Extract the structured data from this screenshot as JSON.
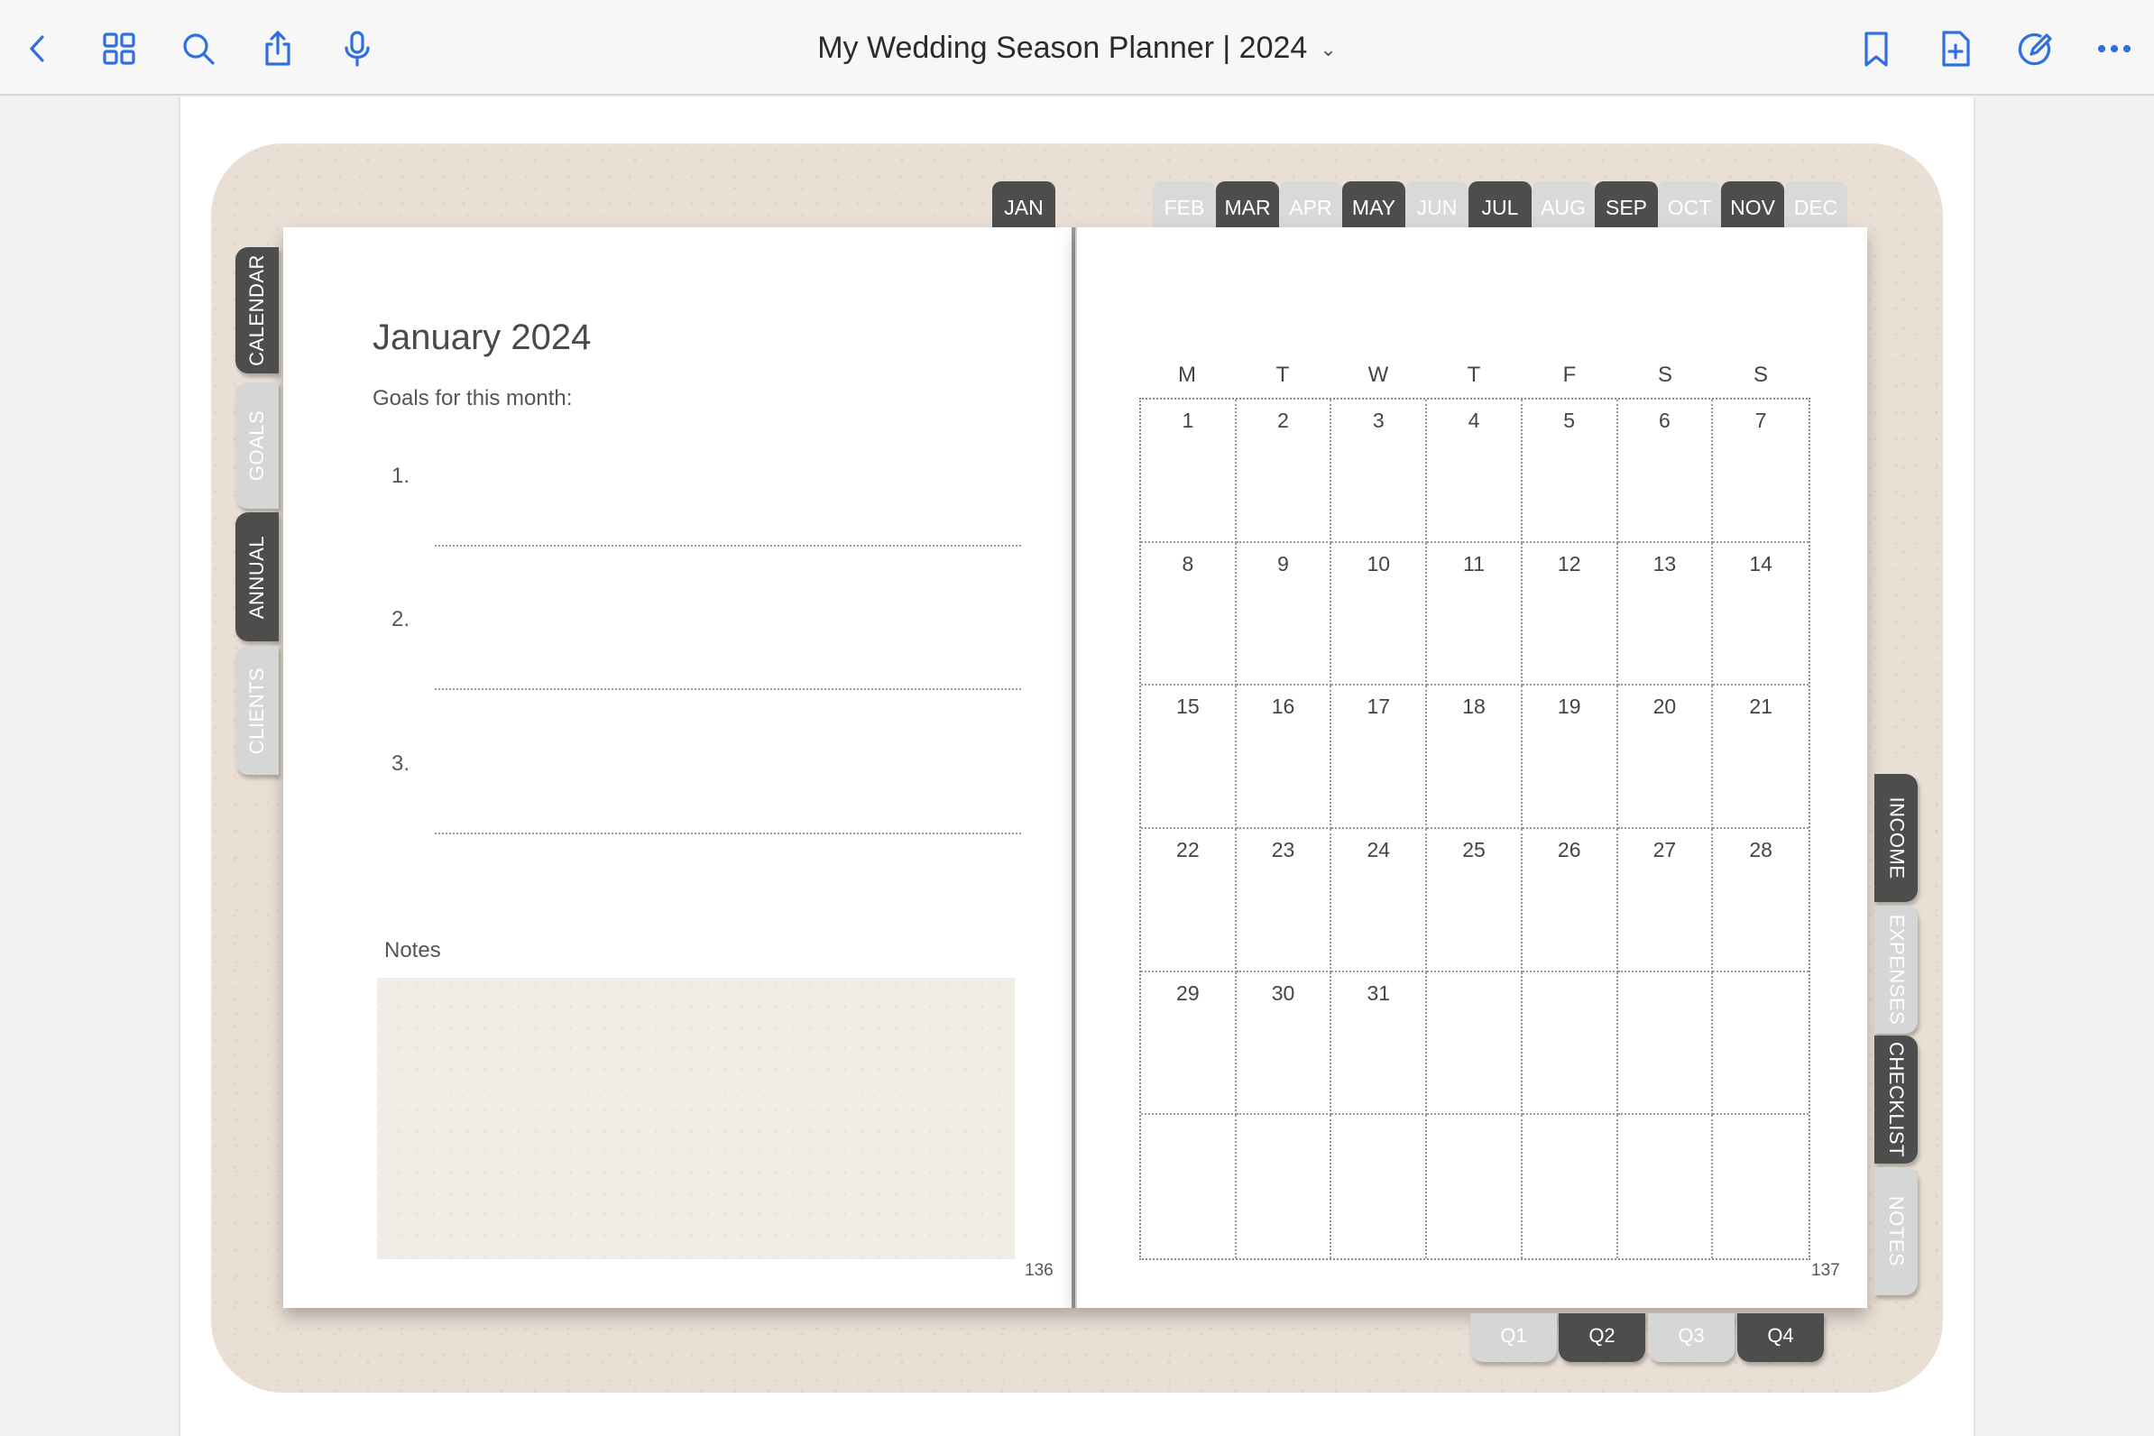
{
  "toolbar": {
    "title": "My Wedding Season Planner | 2024",
    "title_chevron": "⌄",
    "accent": "#2f6fe0",
    "left_icons": [
      "back-icon",
      "grid-icon",
      "search-icon",
      "share-icon",
      "microphone-icon"
    ],
    "right_icons": [
      "bookmark-icon",
      "add-page-icon",
      "edit-icon",
      "more-icon"
    ]
  },
  "planner": {
    "month_tabs": [
      {
        "label": "JAN",
        "style": "dark"
      },
      {
        "label": "FEB",
        "style": "light"
      },
      {
        "label": "MAR",
        "style": "dark"
      },
      {
        "label": "APR",
        "style": "light"
      },
      {
        "label": "MAY",
        "style": "dark"
      },
      {
        "label": "JUN",
        "style": "light"
      },
      {
        "label": "JUL",
        "style": "dark"
      },
      {
        "label": "AUG",
        "style": "light"
      },
      {
        "label": "SEP",
        "style": "dark"
      },
      {
        "label": "OCT",
        "style": "light"
      },
      {
        "label": "NOV",
        "style": "dark"
      },
      {
        "label": "DEC",
        "style": "light"
      }
    ],
    "left_tabs": [
      {
        "label": "CALENDAR",
        "style": "dark"
      },
      {
        "label": "GOALS",
        "style": "light"
      },
      {
        "label": "ANNUAL",
        "style": "dark"
      },
      {
        "label": "CLIENTS",
        "style": "light"
      }
    ],
    "right_tabs": [
      {
        "label": "INCOME",
        "style": "dark"
      },
      {
        "label": "EXPENSES",
        "style": "light"
      },
      {
        "label": "CHECKLIST",
        "style": "dark"
      },
      {
        "label": "NOTES",
        "style": "light"
      }
    ],
    "quarter_tabs": [
      {
        "label": "Q1",
        "style": "light"
      },
      {
        "label": "Q2",
        "style": "dark"
      },
      {
        "label": "Q3",
        "style": "light"
      },
      {
        "label": "Q4",
        "style": "dark"
      }
    ],
    "left_page": {
      "title": "January 2024",
      "goals_label": "Goals for this month:",
      "goals": [
        "1.",
        "2.",
        "3."
      ],
      "notes_label": "Notes",
      "page_number": "136"
    },
    "right_page": {
      "weekdays": [
        "M",
        "T",
        "W",
        "T",
        "F",
        "S",
        "S"
      ],
      "days": [
        "1",
        "2",
        "3",
        "4",
        "5",
        "6",
        "7",
        "8",
        "9",
        "10",
        "11",
        "12",
        "13",
        "14",
        "15",
        "16",
        "17",
        "18",
        "19",
        "20",
        "21",
        "22",
        "23",
        "24",
        "25",
        "26",
        "27",
        "28",
        "29",
        "30",
        "31",
        "",
        "",
        "",
        "",
        "",
        "",
        "",
        "",
        "",
        "",
        ""
      ],
      "page_number": "137"
    }
  }
}
